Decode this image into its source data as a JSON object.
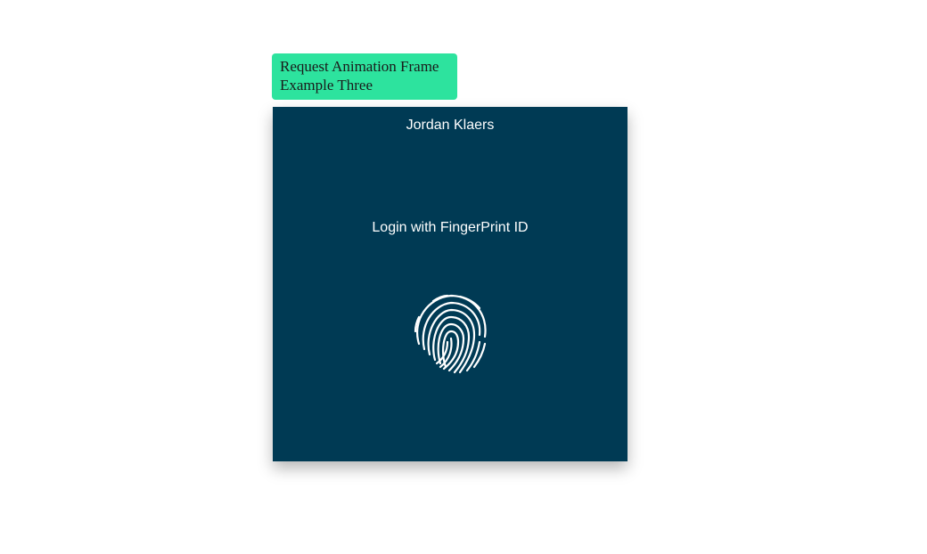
{
  "badge": {
    "line1": "Request Animation Frame",
    "line2": "Example Three",
    "color": "#2de39e"
  },
  "card": {
    "author": "Jordan Klaers",
    "login_text": "Login with FingerPrint ID",
    "background": "#003a54",
    "fingerprint_icon": "fingerprint-icon"
  }
}
